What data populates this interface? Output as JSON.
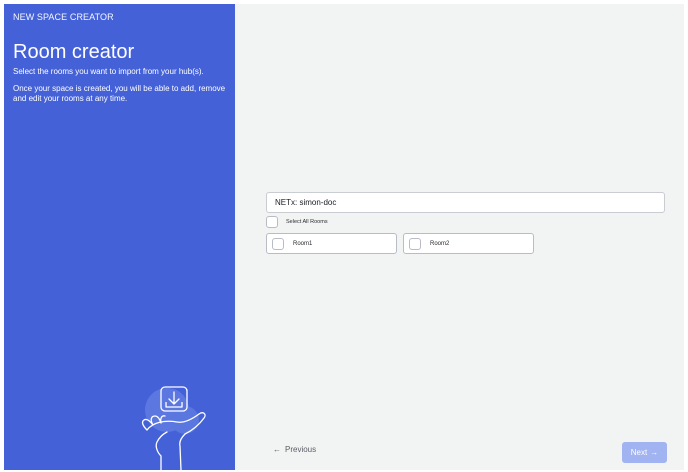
{
  "sidebar": {
    "wizard_label": "NEW SPACE CREATOR",
    "title": "Room creator",
    "description_1": "Select the rooms you want to import from your hub(s).",
    "description_2": "Once your space is created, you will be able to add, remove and edit your rooms at any time.",
    "illustration_icon": "hand-holding-download-icon",
    "background_color": "#4461d8"
  },
  "main": {
    "hub_value": "NETx: simon-doc",
    "select_all_label": "Select All Rooms",
    "select_all_checked": false,
    "rooms": [
      {
        "label": "Room1",
        "checked": false
      },
      {
        "label": "Room2",
        "checked": false
      }
    ]
  },
  "footer": {
    "previous_label": "Previous",
    "previous_icon": "arrow-left-icon",
    "next_label": "Next",
    "next_icon": "arrow-right-icon",
    "next_button_color": "#a1b3f0"
  }
}
